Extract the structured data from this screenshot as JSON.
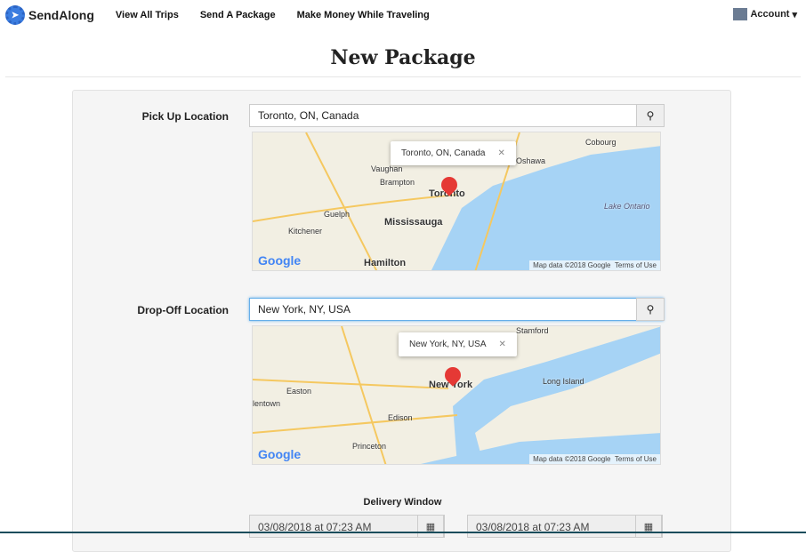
{
  "nav": {
    "brand": "SendAlong",
    "links": [
      "View All Trips",
      "Send A Package",
      "Make Money While Traveling"
    ],
    "account": "Account"
  },
  "page_title": "New Package",
  "pickup": {
    "label": "Pick Up Location",
    "value": "Toronto, ON, Canada",
    "map": {
      "bubble": "Toronto, ON, Canada",
      "cities": [
        "Vaughan",
        "Brampton",
        "Toronto",
        "Mississauga",
        "Guelph",
        "Kitchener",
        "Hamilton",
        "Oshawa",
        "Cobourg",
        "Lake Ontario"
      ],
      "attribution": "Map data ©2018 Google",
      "terms": "Terms of Use"
    }
  },
  "dropoff": {
    "label": "Drop-Off Location",
    "value": "New York, NY, USA",
    "map": {
      "bubble": "New York, NY, USA",
      "cities": [
        "New York",
        "Stamford",
        "Long Island",
        "Easton",
        "Edison",
        "Princeton",
        "lentown"
      ],
      "attribution": "Map data ©2018 Google",
      "terms": "Terms of Use"
    }
  },
  "delivery_window": {
    "label": "Delivery Window",
    "start": "03/08/2018 at 07:23 AM",
    "end": "03/08/2018 at 07:23 AM"
  },
  "google_logo": "Google",
  "colors": {
    "water": "#a6d3f5",
    "accent": "#3b7de0",
    "pin": "#e53935"
  }
}
